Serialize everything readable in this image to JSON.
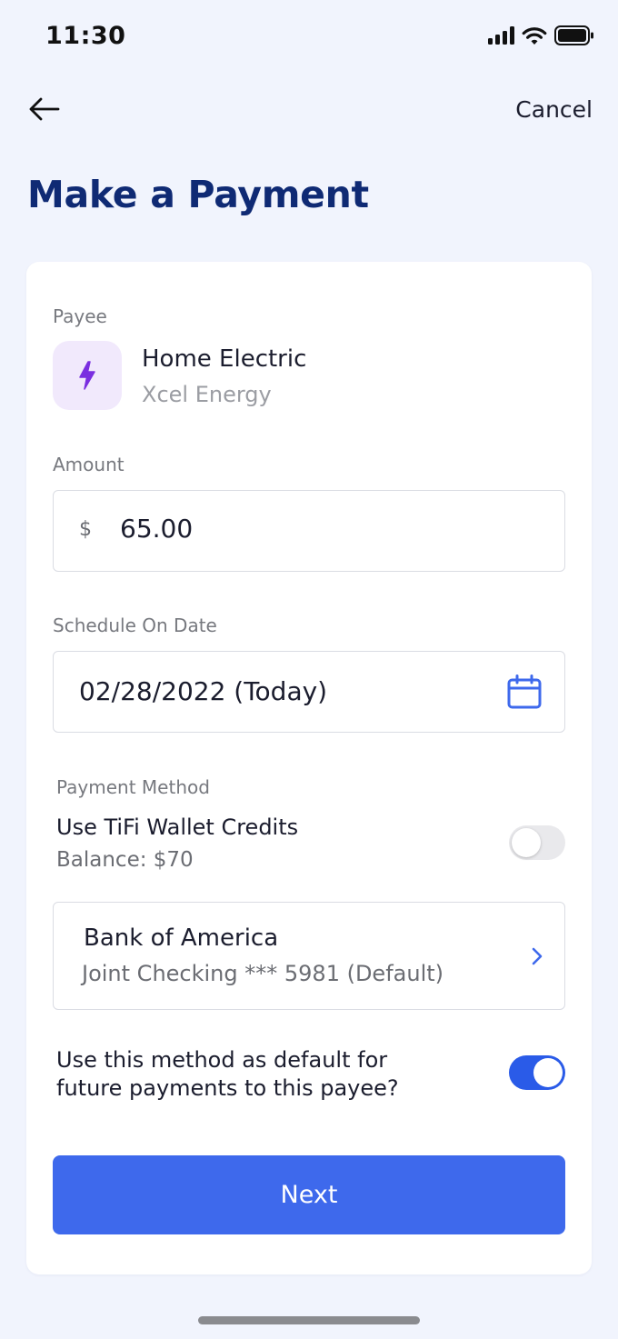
{
  "status_bar": {
    "time": "11:30",
    "icons": [
      "signal-icon",
      "wifi-icon",
      "battery-icon"
    ]
  },
  "nav": {
    "back_icon": "arrow-left-icon",
    "cancel_label": "Cancel"
  },
  "page": {
    "title": "Make a Payment"
  },
  "payee": {
    "label": "Payee",
    "icon": "lightning-bolt-icon",
    "name": "Home Electric",
    "company": "Xcel Energy"
  },
  "amount": {
    "label": "Amount",
    "currency_symbol": "$",
    "value": "65.00"
  },
  "schedule": {
    "label": "Schedule On Date",
    "value": "02/28/2022 (Today)",
    "icon": "calendar-icon"
  },
  "payment_method": {
    "label": "Payment Method",
    "wallet_title": "Use TiFi Wallet Credits",
    "wallet_balance": "Balance: $70",
    "wallet_toggle_on": false,
    "bank_name": "Bank of America",
    "bank_account": "Joint Checking *** 5981 (Default)",
    "bank_icon": "chevron-right-icon"
  },
  "default_option": {
    "text": "Use this method as default for future payments to this payee?",
    "toggle_on": true
  },
  "actions": {
    "next_label": "Next"
  },
  "colors": {
    "background": "#f1f4fd",
    "title": "#0f2a74",
    "accent": "#3e69ec",
    "toggle_on": "#2a5be8",
    "payee_icon_bg": "#f1e9fc",
    "payee_icon": "#7a2ee0"
  }
}
